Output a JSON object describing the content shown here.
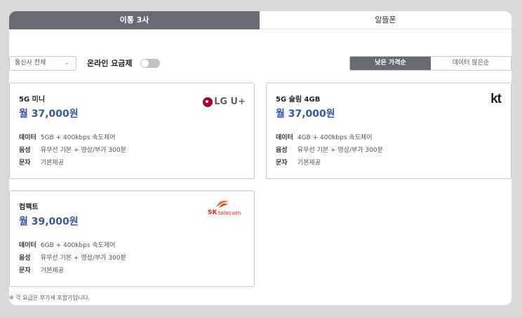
{
  "tabs": [
    {
      "label": "이통 3사",
      "active": true
    },
    {
      "label": "알뜰폰",
      "active": false
    }
  ],
  "filters": {
    "carrier_select": "통신사 전체",
    "online_label": "온라인 요금제",
    "online_toggle": false,
    "sort": [
      {
        "label": "낮은 가격순",
        "active": true
      },
      {
        "label": "데이터 많은순",
        "active": false
      }
    ]
  },
  "spec_labels": {
    "data": "데이터",
    "voice": "음성",
    "sms": "문자"
  },
  "plans": [
    {
      "name": "5G 미니",
      "price": "월 37,000원",
      "carrier_logo": "LG U+",
      "data": "5GB + 400kbps 속도제어",
      "voice": "유무선 기본 + 영상/부가 300분",
      "sms": "기본제공"
    },
    {
      "name": "5G 슬림 4GB",
      "price": "월 37,000원",
      "carrier_logo": "kt",
      "data": "4GB + 400kbps 속도제어",
      "voice": "유무선 기본 + 영상/부가 300분",
      "sms": "기본제공"
    },
    {
      "name": "컴팩트",
      "price": "월 39,000원",
      "carrier_logo": "SK telecom",
      "data": "6GB + 400kbps 속도제어",
      "voice": "유무선 기본 + 영상/부가 300분",
      "sms": "기본제공"
    }
  ],
  "footnote": "※ 각 요금은 부가세 포함가입니다.",
  "colors": {
    "tab_active": "#666b75",
    "price": "#3b56a3",
    "lg": "#a50034",
    "sk": "#e2231a"
  }
}
